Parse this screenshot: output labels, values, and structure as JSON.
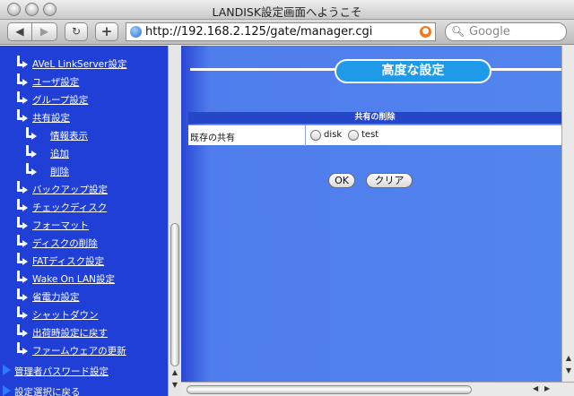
{
  "window": {
    "title": "LANDISK設定画面へようこそ"
  },
  "toolbar": {
    "back_icon": "◀",
    "forward_icon": "▶",
    "reload_icon": "↻",
    "add_icon": "+",
    "url": "http://192.168.2.125/gate/manager.cgi",
    "search_placeholder": "Google",
    "search_icon": "magnifier-icon"
  },
  "sidebar": {
    "items": [
      {
        "label": "AVeL LinkServer設定",
        "level": 1
      },
      {
        "label": "ユーザ設定",
        "level": 1
      },
      {
        "label": "グループ設定",
        "level": 1
      },
      {
        "label": "共有設定",
        "level": 1
      },
      {
        "label": "情報表示",
        "level": 2
      },
      {
        "label": "追加",
        "level": 2
      },
      {
        "label": "削除",
        "level": 2
      },
      {
        "label": "バックアップ設定",
        "level": 1
      },
      {
        "label": "チェックディスク",
        "level": 1
      },
      {
        "label": "フォーマット",
        "level": 1
      },
      {
        "label": "ディスクの削除",
        "level": 1
      },
      {
        "label": "FATディスク設定",
        "level": 1
      },
      {
        "label": "Wake On LAN設定",
        "level": 1
      },
      {
        "label": "省電力設定",
        "level": 1
      },
      {
        "label": "シャットダウン",
        "level": 1
      },
      {
        "label": "出荷時設定に戻す",
        "level": 1
      },
      {
        "label": "ファームウェアの更新",
        "level": 1
      }
    ],
    "top_items": [
      {
        "label": "管理者パスワード設定"
      },
      {
        "label": "設定選択に戻る"
      }
    ]
  },
  "main": {
    "heading": "高度な設定",
    "table_header": "共有の削除",
    "row_label": "既存の共有",
    "options": [
      "disk",
      "test"
    ],
    "ok_label": "OK",
    "clear_label": "クリア"
  },
  "colors": {
    "sidebar_bg": "#1f3fd6",
    "main_bg": "#5284ee",
    "heading_bg": "#1e9ae8",
    "table_header_bg": "#2646c8"
  }
}
